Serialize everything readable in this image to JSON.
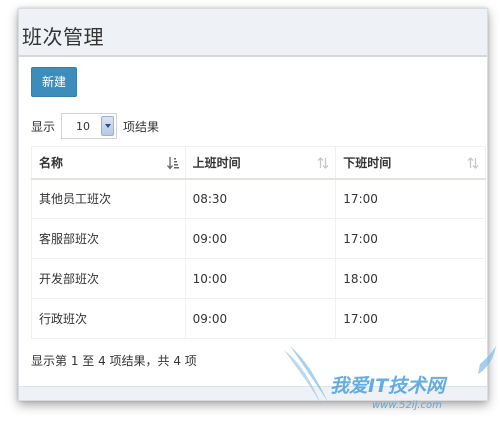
{
  "header": {
    "title": "班次管理"
  },
  "toolbar": {
    "new_label": "新建"
  },
  "length": {
    "prefix": "显示",
    "value": "10",
    "suffix": "项结果"
  },
  "table": {
    "columns": [
      {
        "label": "名称"
      },
      {
        "label": "上班时间"
      },
      {
        "label": "下班时间"
      }
    ],
    "rows": [
      {
        "name": "其他员工班次",
        "start": "08:30",
        "end": "17:00"
      },
      {
        "name": "客服部班次",
        "start": "09:00",
        "end": "17:00"
      },
      {
        "name": "开发部班次",
        "start": "10:00",
        "end": "18:00"
      },
      {
        "name": "行政班次",
        "start": "09:00",
        "end": "17:00"
      }
    ]
  },
  "info": {
    "text": "显示第 1 至 4 项结果，共 4 项"
  },
  "watermark": {
    "text": "我爱IT技术网",
    "url": "www.52ij.com"
  },
  "colors": {
    "primary": "#3c8dbc",
    "header_bg": "#eef1f5"
  }
}
